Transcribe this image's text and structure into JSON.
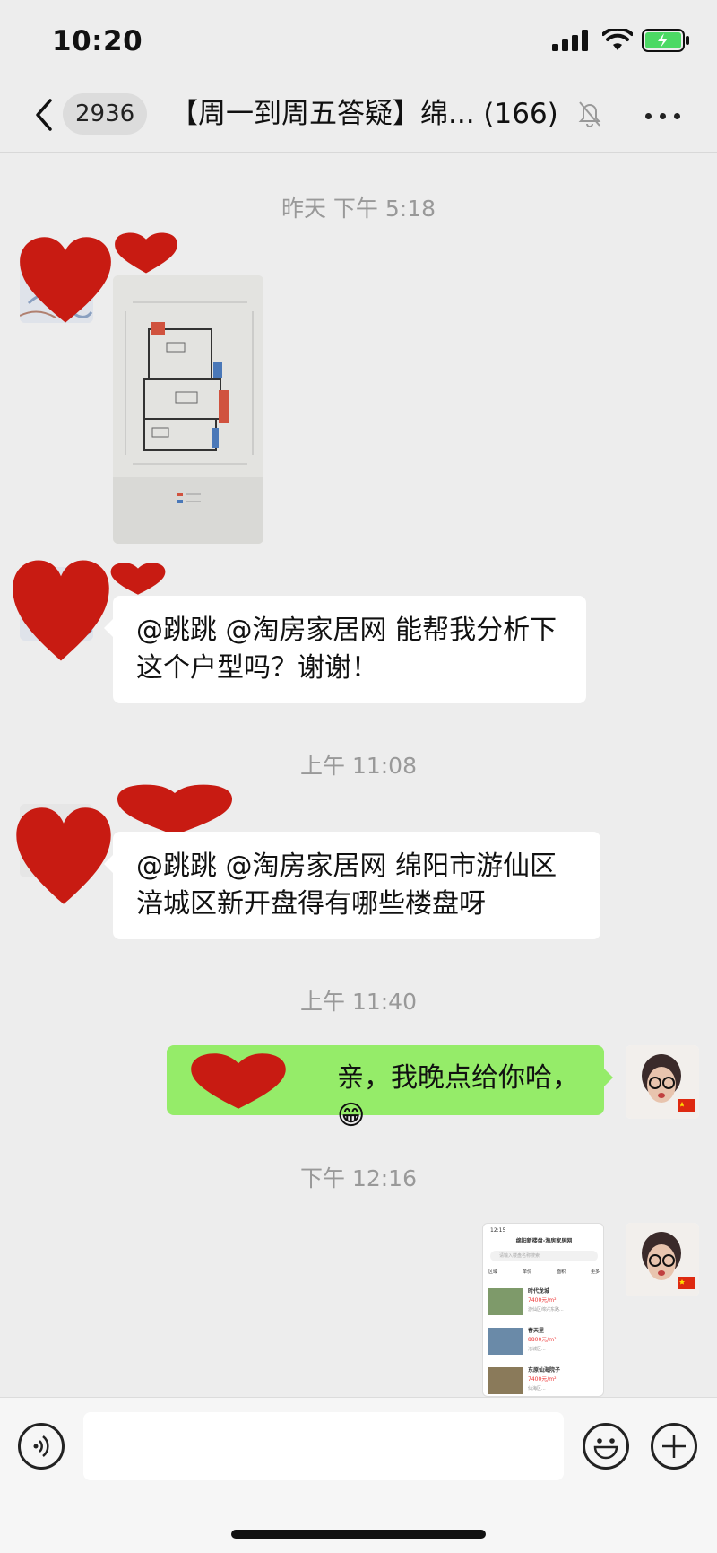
{
  "status": {
    "time": "10:20"
  },
  "nav": {
    "unread_count": "2936",
    "title": "【周一到周五答疑】绵... (166)"
  },
  "messages": {
    "ts1": "昨天 下午 5:18",
    "ts2": "上午 11:08",
    "ts3": "上午 11:40",
    "ts4": "下午 12:16",
    "msg2_text": "@跳跳 @淘房家居网 能帮我分析下这个户型吗？谢谢！",
    "msg3_text": "@跳跳 @淘房家居网  绵阳市游仙区涪城区新开盘得有哪些楼盘呀",
    "msg4_text": "亲，我晚点给你哈，😁"
  },
  "screenshot_preview": {
    "time": "12:15",
    "title": "绵阳新楼盘-淘房家居网",
    "search_placeholder": "请输入楼盘名称搜索",
    "filters": [
      "区域",
      "单价",
      "面积",
      "更多"
    ],
    "listings": [
      {
        "name": "时代龙城",
        "price": "7400元/m²",
        "desc": "游仙区绵兴东路..."
      },
      {
        "name": "春天里",
        "price": "8800元/m²",
        "desc": "涪城区..."
      },
      {
        "name": "东原仙海院子",
        "price": "7400元/m²",
        "desc": "仙海区..."
      }
    ]
  },
  "icons": {
    "back": "chevron-left-icon",
    "mute": "bell-slash-icon",
    "more": "ellipsis-icon",
    "voice": "voice-icon",
    "emoji": "emoji-icon",
    "add": "plus-icon"
  },
  "colors": {
    "background": "#ededed",
    "outgoing_bubble": "#95ec69",
    "incoming_bubble": "#ffffff",
    "redaction_heart": "#c81b12"
  }
}
